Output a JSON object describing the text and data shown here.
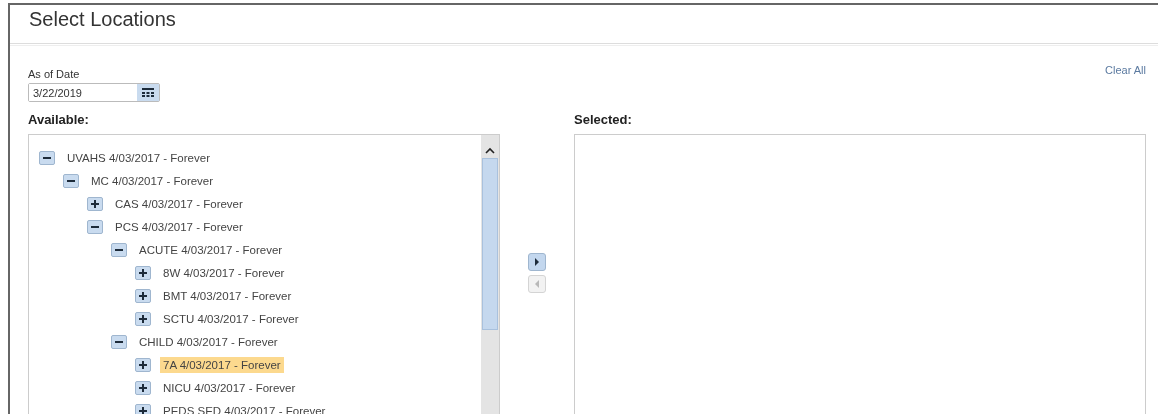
{
  "dialog": {
    "title": "Select Locations"
  },
  "as_of_date": {
    "label": "As of Date",
    "value": "3/22/2019"
  },
  "clear_all": "Clear All",
  "available": {
    "label": "Available:",
    "tree": [
      {
        "label": "UVAHS 4/03/2017 - Forever",
        "expanded": true,
        "selected": false,
        "children": [
          {
            "label": "MC 4/03/2017 - Forever",
            "expanded": true,
            "selected": false,
            "children": [
              {
                "label": "CAS 4/03/2017 - Forever",
                "expanded": false,
                "selected": false
              },
              {
                "label": "PCS 4/03/2017 - Forever",
                "expanded": true,
                "selected": false,
                "children": [
                  {
                    "label": "ACUTE 4/03/2017 - Forever",
                    "expanded": true,
                    "selected": false,
                    "children": [
                      {
                        "label": "8W 4/03/2017 - Forever",
                        "expanded": false,
                        "selected": false
                      },
                      {
                        "label": "BMT 4/03/2017 - Forever",
                        "expanded": false,
                        "selected": false
                      },
                      {
                        "label": "SCTU 4/03/2017 - Forever",
                        "expanded": false,
                        "selected": false
                      }
                    ]
                  },
                  {
                    "label": "CHILD 4/03/2017 - Forever",
                    "expanded": true,
                    "selected": false,
                    "children": [
                      {
                        "label": "7A 4/03/2017 - Forever",
                        "expanded": false,
                        "selected": true
                      },
                      {
                        "label": "NICU 4/03/2017 - Forever",
                        "expanded": false,
                        "selected": false
                      },
                      {
                        "label": "PEDS SED 4/03/2017 - Forever",
                        "expanded": false,
                        "selected": false
                      }
                    ]
                  }
                ]
              }
            ]
          }
        ]
      }
    ]
  },
  "move_buttons": [
    {
      "kind": "add",
      "disabled": false
    },
    {
      "kind": "remove",
      "disabled": true
    }
  ],
  "selected": {
    "label": "Selected:"
  }
}
